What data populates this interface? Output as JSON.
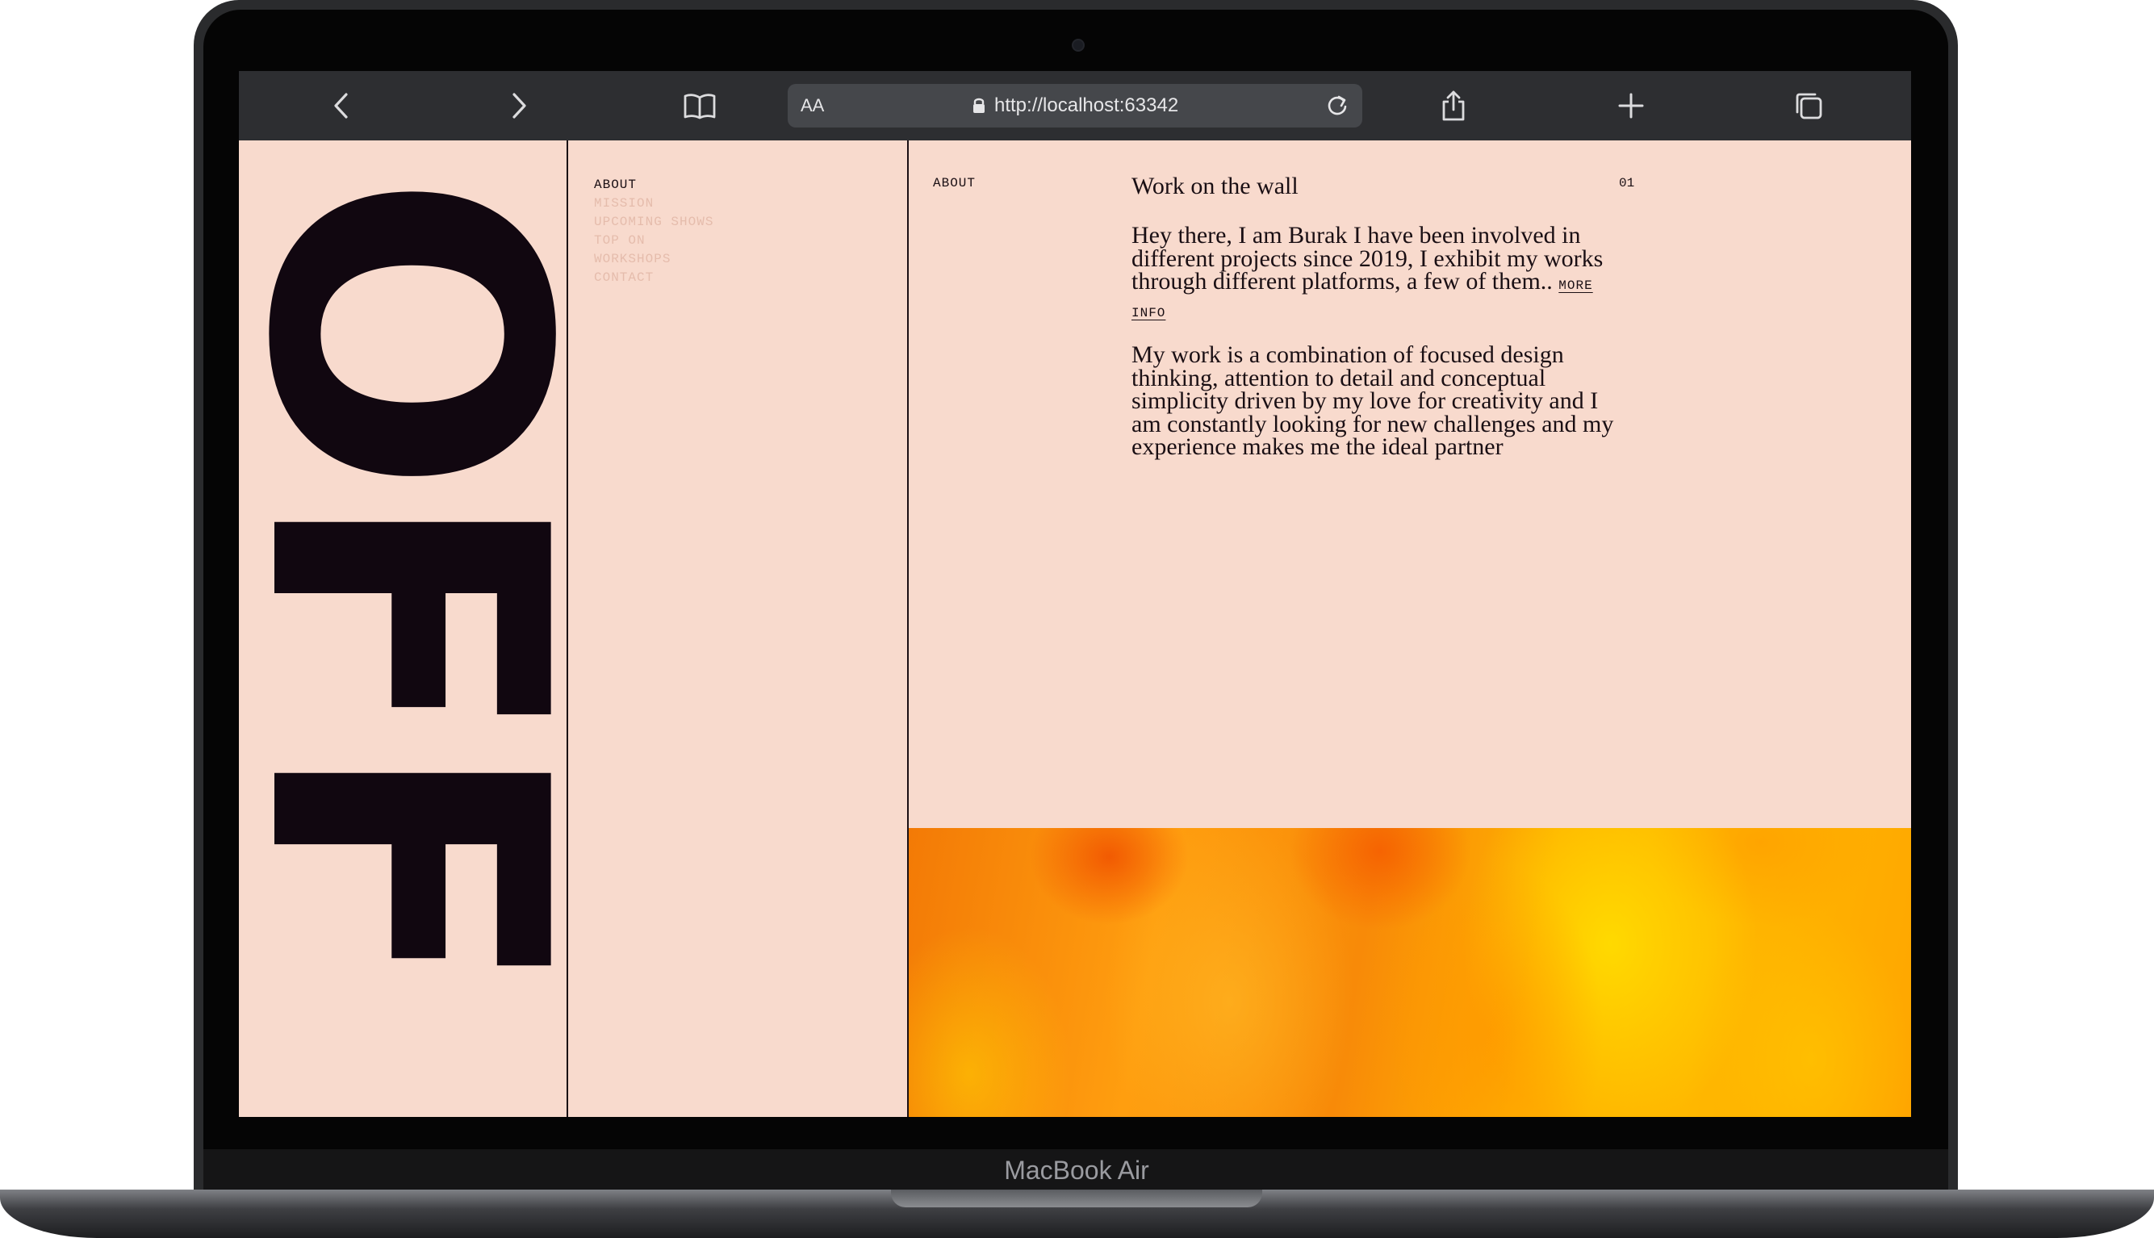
{
  "device": {
    "brand_label": "MacBook Air"
  },
  "browser": {
    "text_size_label": "AA",
    "url": "http://localhost:63342",
    "icons": {
      "back": "chevron-left-icon",
      "forward": "chevron-right-icon",
      "bookmarks": "book-icon",
      "lock": "lock-icon",
      "reload": "reload-icon",
      "share": "share-icon",
      "new_tab": "plus-icon",
      "tabs": "tabs-icon"
    }
  },
  "site": {
    "logo_text": "OFF",
    "nav": {
      "items": [
        {
          "label": "ABOUT",
          "active": true
        },
        {
          "label": "MISSION",
          "active": false
        },
        {
          "label": "UPCOMING SHOWS",
          "active": false
        },
        {
          "label": "TOP ON",
          "active": false
        },
        {
          "label": "WORKSHOPS",
          "active": false
        },
        {
          "label": "CONTACT",
          "active": false
        }
      ]
    },
    "section": {
      "label": "ABOUT",
      "number": "01",
      "heading": "Work on the wall",
      "paragraph1": "Hey there, I am Burak I have been involved in different projects since 2019, I exhibit my works through different platforms, a few of them..",
      "more_link": "MORE INFO",
      "paragraph2": "My work is a combination of focused design thinking, attention to detail and conceptual simplicity driven by my love for creativity and I am constantly looking for new challenges and my experience makes me the ideal partner"
    },
    "colors": {
      "background": "#f8dacd",
      "ink": "#1a0f14",
      "nav_dim": "#e5bcac",
      "toolbar": "#2d2e31"
    }
  }
}
